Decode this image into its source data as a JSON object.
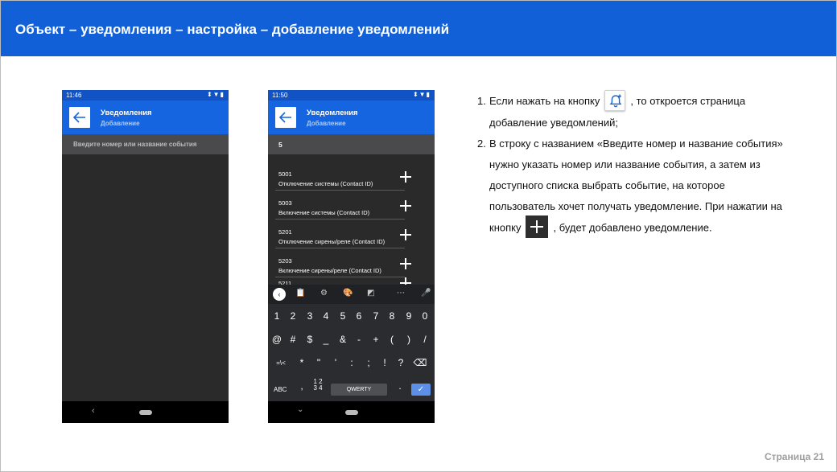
{
  "header": {
    "title": "Объект – уведомления – настройка – добавление уведомлений"
  },
  "phone1": {
    "time": "11:46",
    "status_icons": "⬍▼▮",
    "appbar_title": "Уведомления",
    "appbar_subtitle": "Добавление",
    "search_placeholder": "Введите номер или название события",
    "nav_back": "‹"
  },
  "phone2": {
    "time": "11:50",
    "status_icons": "⬍▼▮",
    "appbar_title": "Уведомления",
    "appbar_subtitle": "Добавление",
    "search_value": "5",
    "events": [
      {
        "code": "5001",
        "name": "Отключение системы (Contact ID)"
      },
      {
        "code": "5003",
        "name": "Включение системы (Contact ID)"
      },
      {
        "code": "5201",
        "name": "Отключение сирены/реле (Contact ID)"
      },
      {
        "code": "5203",
        "name": "Включение сирены/реле (Contact ID)"
      },
      {
        "code": "5211",
        "name": ""
      }
    ],
    "keyboard": {
      "toolbar": {
        "collapse": "‹",
        "clipboard": "📋",
        "settings": "⚙",
        "theme": "🎨",
        "resize": "◩",
        "more": "⋯",
        "mic": "🎤"
      },
      "row1": [
        "1",
        "2",
        "3",
        "4",
        "5",
        "6",
        "7",
        "8",
        "9",
        "0"
      ],
      "row2": [
        "@",
        "#",
        "$",
        "_",
        "&",
        "-",
        "+",
        "(",
        ")",
        "/"
      ],
      "row3": [
        "=\\<",
        "*",
        "\"",
        "'",
        ":",
        ";",
        "!",
        "?",
        "⌫"
      ],
      "row4": {
        "abc": "ABC",
        "comma": ",",
        "numpad_top": "1 2",
        "numpad_bottom": "3 4",
        "space": "QWERTY",
        "period": ".",
        "ok": "✓"
      }
    },
    "nav_down": "⌄"
  },
  "instructions": {
    "item1_num": "1.",
    "item1_a": "Если нажать на кнопку",
    "item1_b": ", то откроется страница добавление уведомлений;",
    "item2_num": "2.",
    "item2_a": "В строку с названием «Введите номер и название события» нужно указать номер или название события, а затем из доступного списка выбрать событие, на которое пользователь хочет получать уведомление. При нажатии на кнопку",
    "item2_b": ", будет добавлено уведомление."
  },
  "footer": {
    "page": "Страница 21"
  },
  "colors": {
    "header_bg": "#1160d8",
    "appbar": "#1565e0",
    "phone_bg": "#2a2a2a",
    "accent_key": "#5b8fe8"
  }
}
